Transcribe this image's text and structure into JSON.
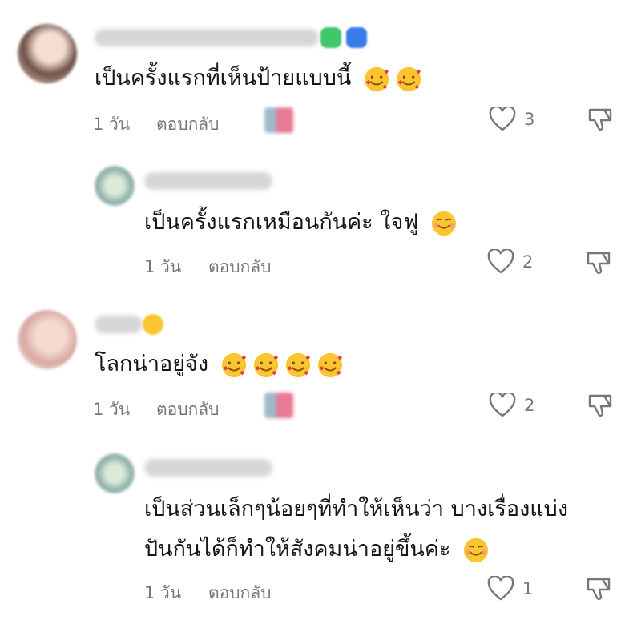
{
  "comments": [
    {
      "text": "เป็นครั้งแรกที่เห็นป้ายแบบนี้",
      "emojis": [
        "smiling-face-with-hearts",
        "smiling-face-with-hearts"
      ],
      "time": "1 วัน",
      "reply_label": "ตอบกลับ",
      "likes": "3"
    },
    {
      "text": "เป็นครั้งแรกเหมือนกันค่ะ ใจฟู",
      "emojis": [
        "smiling-face"
      ],
      "time": "1 วัน",
      "reply_label": "ตอบกลับ",
      "likes": "2"
    },
    {
      "text": "โลกน่าอยู่จัง",
      "emojis": [
        "smiling-face-with-hearts",
        "smiling-face-with-hearts",
        "smiling-face-with-hearts",
        "smiling-face-with-hearts"
      ],
      "time": "1 วัน",
      "reply_label": "ตอบกลับ",
      "likes": "2"
    },
    {
      "text_line1": "เป็นส่วนเล็กๆน้อยๆที่ทำให้เห็นว่า บางเรื่องแบ่ง",
      "text_line2": "ปันกันได้ก็ทำให้สังคมน่าอยู่ขึ้นค่ะ",
      "emojis": [
        "smiling-face"
      ],
      "time": "1 วัน",
      "reply_label": "ตอบกลับ",
      "likes": "1"
    }
  ],
  "colors": {
    "heart_green": "#3ec86a",
    "heart_blue": "#3a7bea",
    "emoji_yellow": "#fbc531",
    "muted_text": "#777777"
  }
}
